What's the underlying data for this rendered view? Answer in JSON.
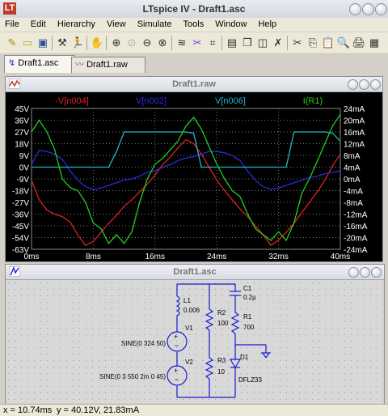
{
  "window": {
    "title": "LTspice IV - Draft1.asc",
    "logo_text": "LT"
  },
  "menu": [
    "File",
    "Edit",
    "Hierarchy",
    "View",
    "Simulate",
    "Tools",
    "Window",
    "Help"
  ],
  "tabs": [
    {
      "label": "Draft1.asc"
    },
    {
      "label": "Draft1.raw"
    }
  ],
  "waveform": {
    "title": "Draft1.raw",
    "traces": [
      {
        "name": "-V[n004]",
        "color": "#e02020"
      },
      {
        "name": "V[n002]",
        "color": "#2a2ae0"
      },
      {
        "name": "V[n006]",
        "color": "#20b8c8"
      },
      {
        "name": "I(R1)",
        "color": "#20d020"
      }
    ]
  },
  "chart_data": {
    "type": "line",
    "x": [
      0,
      1,
      2,
      3,
      4,
      5,
      6,
      7,
      8,
      9,
      10,
      11,
      12,
      13,
      14,
      15,
      16,
      17,
      18,
      19,
      20,
      21,
      22,
      23,
      24,
      25,
      26,
      27,
      28,
      29,
      30,
      31,
      32,
      33,
      34,
      35,
      36,
      37,
      38,
      39,
      40
    ],
    "xlim": [
      0,
      40
    ],
    "xticks": [
      "0ms",
      "8ms",
      "16ms",
      "24ms",
      "32ms",
      "40ms"
    ],
    "ylim_left": [
      -63,
      45
    ],
    "yticks_left": [
      "45V",
      "36V",
      "27V",
      "18V",
      "9V",
      "0V",
      "-9V",
      "-18V",
      "-27V",
      "-36V",
      "-45V",
      "-54V",
      "-63V"
    ],
    "ylim_right": [
      -24,
      24
    ],
    "yticks_right": [
      "24mA",
      "20mA",
      "16mA",
      "12mA",
      "8mA",
      "4mA",
      "0mA",
      "-4mA",
      "-8mA",
      "-12mA",
      "-16mA",
      "-20mA",
      "-24mA"
    ],
    "grid": true,
    "series": [
      {
        "name": "-V[n004]",
        "axis": "left",
        "color": "#e02020",
        "values": [
          -10,
          -25,
          -33,
          -36,
          -38,
          -42,
          -52,
          -60,
          -57,
          -50,
          -43,
          -37,
          -30,
          -25,
          -19,
          -13,
          -6,
          2,
          8,
          15,
          21,
          18,
          10,
          0,
          -10,
          -18,
          -25,
          -32,
          -38,
          -45,
          -52,
          -60,
          -56,
          -50,
          -43,
          -35,
          -27,
          -19,
          -10,
          1,
          10
        ]
      },
      {
        "name": "V[n002]",
        "axis": "left",
        "color": "#2a2ae0",
        "values": [
          2,
          13,
          12,
          10,
          6,
          -3,
          -10,
          -15,
          -17,
          -16,
          -14,
          -12,
          -10,
          -9,
          -7,
          -4,
          -3,
          0,
          2,
          5,
          7,
          8,
          10,
          12,
          12,
          11,
          9,
          5,
          -3,
          -10,
          -15,
          -17,
          -16,
          -14,
          -12,
          -10,
          -8,
          -7,
          -5,
          -4,
          -3
        ]
      },
      {
        "name": "V[n006]",
        "axis": "left",
        "color": "#20b8c8",
        "values": [
          0,
          0,
          0,
          0,
          0,
          0,
          0,
          0,
          0,
          0,
          0,
          12,
          27,
          27,
          27,
          27,
          27,
          27,
          27,
          27,
          27,
          26,
          0,
          0,
          0,
          0,
          0,
          0,
          0,
          0,
          0,
          0,
          0,
          0,
          27,
          27,
          27,
          27,
          27,
          26,
          20
        ]
      },
      {
        "name": "I(R1)",
        "axis": "right",
        "color": "#20d020",
        "values": [
          16,
          20,
          16,
          10,
          0,
          -3,
          -4,
          -8,
          -15,
          -17,
          -22,
          -19,
          -22,
          -18,
          -8,
          0,
          5,
          7,
          10,
          13,
          18,
          21,
          17,
          11,
          5,
          0,
          -4,
          -6,
          -12,
          -17,
          -19,
          -21,
          -18,
          -21,
          -15,
          -5,
          0,
          6,
          12,
          18,
          22
        ]
      }
    ]
  },
  "schematic": {
    "title": "Draft1.asc",
    "labels": {
      "l1": "L1",
      "l1_val": "0.006",
      "v1": "V1",
      "v1_val": "SINE(0 324 50)",
      "v2": "V2",
      "v2_val": "SINE(0 3 550 2m 0 45)",
      "r2": "R2",
      "r2_val": "100",
      "r3": "R3",
      "r3_val": "10",
      "c1": "C1",
      "c1_val": "0.2µ",
      "r1": "R1",
      "r1_val": "700",
      "d1": "D1",
      "d1_val": "DFLZ33"
    }
  },
  "status": {
    "x": "x = 10.74ms",
    "y": "y = 40.12V, 21.83mA"
  }
}
